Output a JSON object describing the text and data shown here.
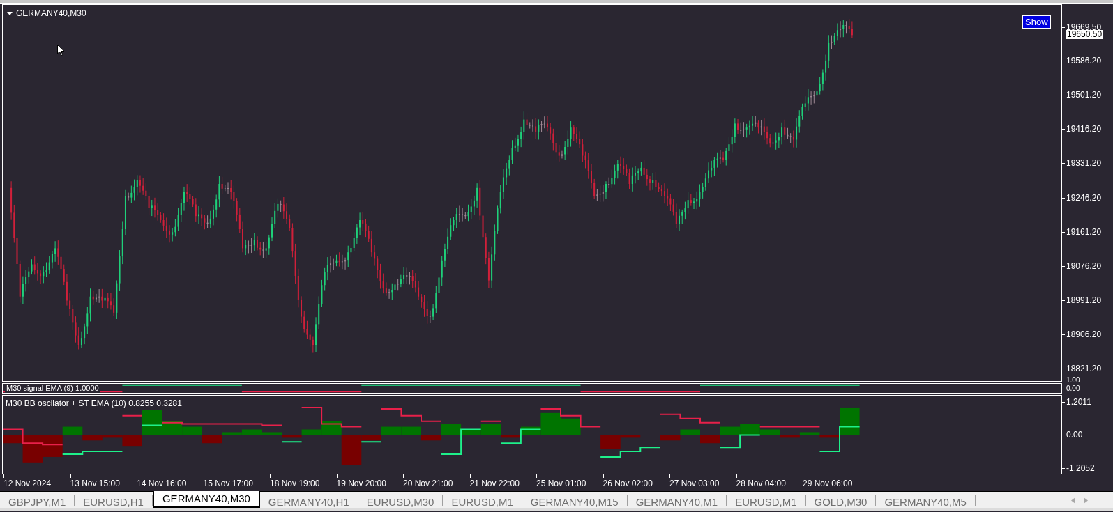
{
  "chart": {
    "symbol": "GERMANY40,M30",
    "show_button": "Show",
    "current_price": "19650.50",
    "price_axis": [
      "19669.50",
      "19586.20",
      "19501.20",
      "19416.20",
      "19331.20",
      "19246.20",
      "19161.20",
      "19076.20",
      "18991.20",
      "18906.20",
      "18821.20"
    ]
  },
  "signal": {
    "label": "M30 signal EMA (9) 1.0000",
    "axis_labels": [
      "1.00",
      "0.00"
    ]
  },
  "oscillator": {
    "label": "M30 BB oscilator + ST EMA (10) 0.8255 0.3281",
    "axis_labels": [
      "1.2011",
      "0.00",
      "-1.2052"
    ]
  },
  "time_axis": [
    "12 Nov 2024",
    "13 Nov 15:00",
    "14 Nov 16:00",
    "15 Nov 17:00",
    "18 Nov 19:00",
    "19 Nov 20:00",
    "20 Nov 21:00",
    "21 Nov 22:00",
    "25 Nov 01:00",
    "26 Nov 02:00",
    "27 Nov 03:00",
    "28 Nov 04:00",
    "29 Nov 06:00"
  ],
  "tabs": [
    {
      "label": "GBPJPY,M1",
      "selected": false
    },
    {
      "label": "EURUSD,H1",
      "selected": false
    },
    {
      "label": "GERMANY40,M30",
      "selected": true
    },
    {
      "label": "GERMANY40,H1",
      "selected": false
    },
    {
      "label": "EURUSD,M30",
      "selected": false
    },
    {
      "label": "EURUSD,M1",
      "selected": false
    },
    {
      "label": "GERMANY40,M15",
      "selected": false
    },
    {
      "label": "GERMANY40,M1",
      "selected": false
    },
    {
      "label": "EURUSD,M1",
      "selected": false
    },
    {
      "label": "GOLD,M30",
      "selected": false
    },
    {
      "label": "GERMANY40,M5",
      "selected": false
    }
  ]
}
